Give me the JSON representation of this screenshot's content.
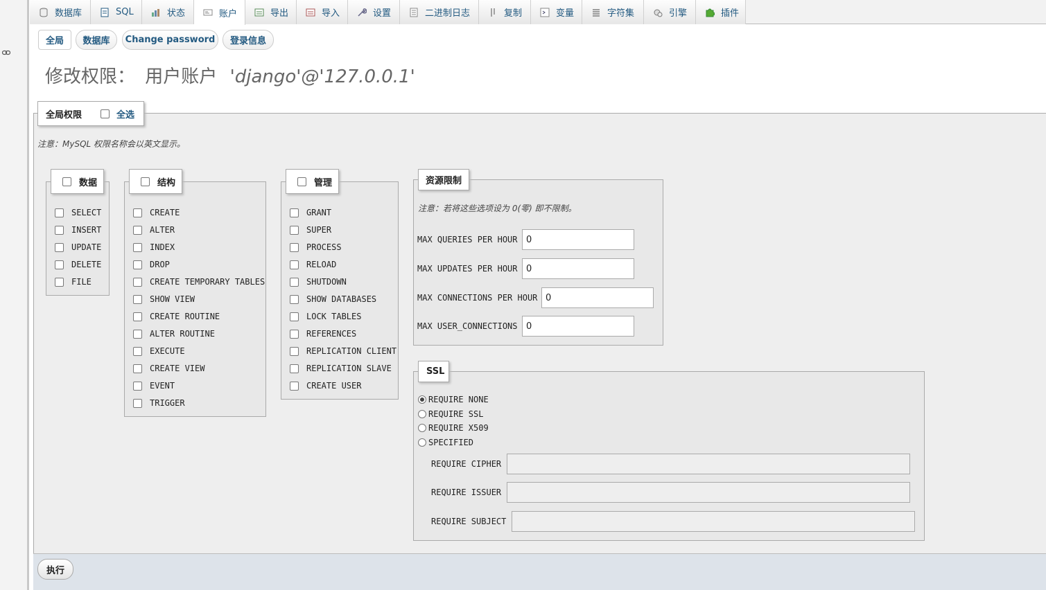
{
  "topnav": {
    "tabs": [
      {
        "label": "数据库",
        "icon": "database-icon"
      },
      {
        "label": "SQL",
        "icon": "sql-icon"
      },
      {
        "label": "状态",
        "icon": "status-icon"
      },
      {
        "label": "账户",
        "icon": "accounts-icon"
      },
      {
        "label": "导出",
        "icon": "export-icon"
      },
      {
        "label": "导入",
        "icon": "import-icon"
      },
      {
        "label": "设置",
        "icon": "wrench-icon"
      },
      {
        "label": "二进制日志",
        "icon": "binlog-icon"
      },
      {
        "label": "复制",
        "icon": "replication-icon"
      },
      {
        "label": "变量",
        "icon": "variables-icon"
      },
      {
        "label": "字符集",
        "icon": "charset-icon"
      },
      {
        "label": "引擎",
        "icon": "engine-icon"
      },
      {
        "label": "插件",
        "icon": "puzzle-icon"
      }
    ],
    "active": "账户"
  },
  "subtabs": [
    "全局",
    "数据库",
    "Change password",
    "登录信息"
  ],
  "title": {
    "prefix": "修改权限：",
    "label": "用户账户",
    "user": "'django'@'127.0.0.1'"
  },
  "global": {
    "legend": "全局权限",
    "select_all": "全选",
    "note": "注意：MySQL 权限名称会以英文显示。"
  },
  "groups": {
    "data": {
      "title": "数据",
      "items": [
        "SELECT",
        "INSERT",
        "UPDATE",
        "DELETE",
        "FILE"
      ]
    },
    "structure": {
      "title": "结构",
      "items": [
        "CREATE",
        "ALTER",
        "INDEX",
        "DROP",
        "CREATE TEMPORARY TABLES",
        "SHOW VIEW",
        "CREATE ROUTINE",
        "ALTER ROUTINE",
        "EXECUTE",
        "CREATE VIEW",
        "EVENT",
        "TRIGGER"
      ]
    },
    "admin": {
      "title": "管理",
      "items": [
        "GRANT",
        "SUPER",
        "PROCESS",
        "RELOAD",
        "SHUTDOWN",
        "SHOW DATABASES",
        "LOCK TABLES",
        "REFERENCES",
        "REPLICATION CLIENT",
        "REPLICATION SLAVE",
        "CREATE USER"
      ]
    }
  },
  "limits": {
    "title": "资源限制",
    "note": "注意：若将这些选项设为 0(零) 即不限制。",
    "rows": [
      {
        "label": "MAX QUERIES PER HOUR",
        "value": "0"
      },
      {
        "label": "MAX UPDATES PER HOUR",
        "value": "0"
      },
      {
        "label": "MAX CONNECTIONS PER HOUR",
        "value": "0"
      },
      {
        "label": "MAX USER_CONNECTIONS",
        "value": "0"
      }
    ]
  },
  "ssl": {
    "title": "SSL",
    "options": [
      "REQUIRE NONE",
      "REQUIRE SSL",
      "REQUIRE X509",
      "SPECIFIED"
    ],
    "selected": "REQUIRE NONE",
    "fields": [
      "REQUIRE CIPHER",
      "REQUIRE ISSUER",
      "REQUIRE SUBJECT"
    ]
  },
  "footer": {
    "go": "执行"
  }
}
